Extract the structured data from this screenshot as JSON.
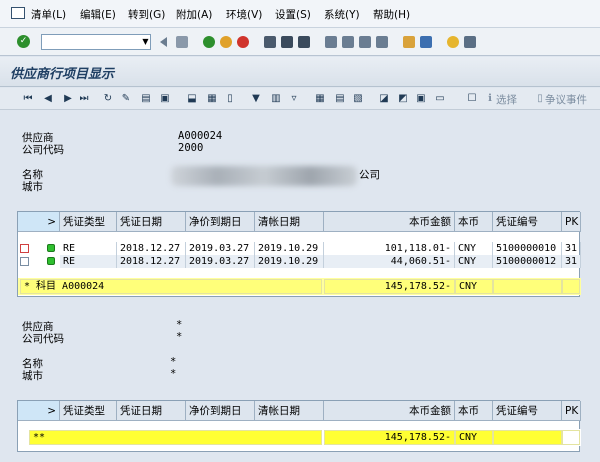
{
  "menu": {
    "items": [
      "清单(L)",
      "编辑(E)",
      "转到(G)",
      "附加(A)",
      "环境(V)",
      "设置(S)",
      "系统(Y)",
      "帮助(H)"
    ]
  },
  "title": "供应商行项目显示",
  "toolbar": {
    "select_label": "选择",
    "note_label": "争议事件"
  },
  "header1": {
    "vendor_label": "供应商",
    "vendor_value": "A000024",
    "company_label": "公司代码",
    "company_value": "2000",
    "name_label": "名称",
    "name_value": "公司",
    "city_label": "城市"
  },
  "columns": [
    "凭证类型",
    "凭证日期",
    "净价到期日",
    "清帐日期",
    "本币金额",
    "本币",
    "凭证编号",
    "PK"
  ],
  "column_marker": ">",
  "rows": [
    {
      "type": "RE",
      "doc_date": "2018.12.27",
      "net_due": "2019.03.27",
      "clear_date": "2019.10.29",
      "amount": "101,118.01-",
      "currency": "CNY",
      "doc_no": "5100000010",
      "pk": "31",
      "status": "green"
    },
    {
      "type": "RE",
      "doc_date": "2018.12.27",
      "net_due": "2019.03.27",
      "clear_date": "2019.10.29",
      "amount": "44,060.51-",
      "currency": "CNY",
      "doc_no": "5100000012",
      "pk": "31",
      "status": "green"
    }
  ],
  "subtotal": {
    "label": "* 科目 A000024",
    "amount": "145,178.52-",
    "currency": "CNY"
  },
  "header2": {
    "vendor_label": "供应商",
    "vendor_value": "*",
    "company_label": "公司代码",
    "company_value": "*",
    "name_label": "名称",
    "name_value": "*",
    "city_label": "城市",
    "city_value": "*"
  },
  "total": {
    "label": "**",
    "amount": "145,178.52-",
    "currency": "CNY"
  },
  "colors": {
    "yellow_total": "#ffff33",
    "subtotal": "#ffff7a",
    "status_green": "#2fbf2f",
    "title_text": "#1f3f63"
  }
}
